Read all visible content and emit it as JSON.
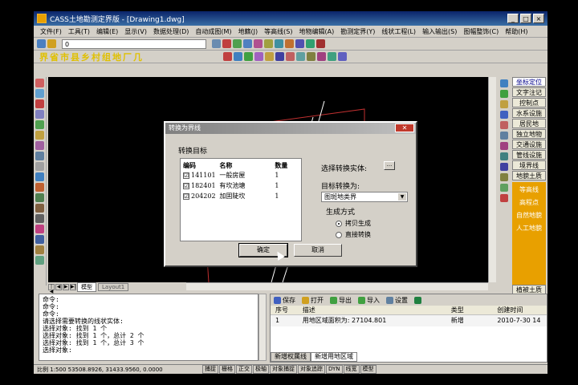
{
  "window": {
    "title": "CASS土地勘测定界版 - [Drawing1.dwg]",
    "controls": [
      "_",
      "□",
      "×"
    ]
  },
  "menu": [
    "文件(F)",
    "工具(T)",
    "编辑(E)",
    "显示(V)",
    "数据处理(D)",
    "自动成图(M)",
    "地籍(J)",
    "等高线(S)",
    "地物编辑(A)",
    "勘测定界(Y)",
    "线状工程(L)",
    "输入输出(S)",
    "图幅整饰(C)",
    "帮助(H)"
  ],
  "toolbar": {
    "layer_value": "0"
  },
  "cad_chars": [
    "界",
    "省",
    "市",
    "县",
    "乡",
    "村",
    "组",
    "地",
    "厂",
    "几"
  ],
  "right_panel": {
    "buttons": [
      "坐标定位",
      "文字注记",
      "控制点",
      "水系设施",
      "居民地",
      "独立地物",
      "交通设施",
      "管线设施",
      "境界线",
      "地貌土质"
    ],
    "tree": [
      "等高线",
      "高程点",
      "自然地貌",
      "人工地貌"
    ],
    "bottom": "植被土质"
  },
  "layout_tabs": [
    "模型",
    "Layout1"
  ],
  "command_lines": [
    "命令:",
    "命令:",
    "命令:",
    "请选择需要转换的线状实体:",
    "选择对象: 找到 1 个",
    "选择对象: 找到 1 个，总计 2 个",
    "选择对象: 找到 1 个，总计 3 个",
    "选择对象:"
  ],
  "prop_toolbar": [
    "保存",
    "打开",
    "导出",
    "导入",
    "设置"
  ],
  "prop_table": {
    "headers": [
      "序号",
      "描述",
      "类型",
      "创建时间"
    ],
    "rows": [
      {
        "id": "1",
        "desc": "用地区域面积为: 27104.801",
        "type": "新增",
        "time": "2010-7-30 14"
      }
    ]
  },
  "prop_tabs": [
    "新增权属线",
    "新增用地区域"
  ],
  "status": {
    "coord": "比例 1:500  53508.8926, 31433.9560, 0.0000",
    "buttons": [
      "捕捉",
      "栅格",
      "正交",
      "极轴",
      "对象捕捉",
      "对象追踪",
      "DYN",
      "线宽",
      "模型"
    ]
  },
  "dialog": {
    "title": "转换为界线",
    "group_label": "转换目标",
    "headers": [
      "编码",
      "名称",
      "数量"
    ],
    "rows": [
      {
        "code": "141101",
        "name": "一般房屋",
        "count": "1",
        "checked": "☑"
      },
      {
        "code": "182401",
        "name": "有坎池塘",
        "count": "1",
        "checked": "☑"
      },
      {
        "code": "204202",
        "name": "加固陡坎",
        "count": "1",
        "checked": "☑"
      }
    ],
    "select_label": "选择转换实体:",
    "browse_label": "...",
    "target_label": "目标转换为:",
    "target_value": "图斑地类界",
    "method_label": "生成方式",
    "radio_copy": "拷贝生成",
    "radio_direct": "直接转换",
    "ok": "确定",
    "cancel": "取消"
  },
  "colors": {
    "title_gradient_start": "#0a246a",
    "tree_orange": "#e8a000",
    "dialog_close": "#c0392b"
  }
}
